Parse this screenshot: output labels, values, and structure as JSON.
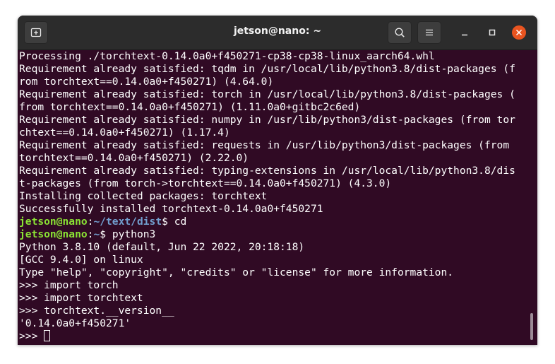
{
  "window": {
    "title": "jetson@nano: ~"
  },
  "icons": {
    "new_tab": "new-tab-icon",
    "search": "search-icon",
    "menu": "hamburger-menu-icon",
    "minimize": "minimize-icon",
    "maximize": "maximize-icon",
    "close": "close-icon"
  },
  "colors": {
    "terminal_bg": "#300a24",
    "titlebar_bg": "#2c2c2c",
    "prompt_user": "#8ae234",
    "prompt_path": "#729fcf",
    "close_button": "#e95420"
  },
  "terminal": {
    "lines": [
      "Processing ./torchtext-0.14.0a0+f450271-cp38-cp38-linux_aarch64.whl",
      "Requirement already satisfied: tqdm in /usr/local/lib/python3.8/dist-packages (f",
      "rom torchtext==0.14.0a0+f450271) (4.64.0)",
      "Requirement already satisfied: torch in /usr/local/lib/python3.8/dist-packages (",
      "from torchtext==0.14.0a0+f450271) (1.11.0a0+gitbc2c6ed)",
      "Requirement already satisfied: numpy in /usr/lib/python3/dist-packages (from tor",
      "chtext==0.14.0a0+f450271) (1.17.4)",
      "Requirement already satisfied: requests in /usr/lib/python3/dist-packages (from",
      "torchtext==0.14.0a0+f450271) (2.22.0)",
      "Requirement already satisfied: typing-extensions in /usr/local/lib/python3.8/dis",
      "t-packages (from torch->torchtext==0.14.0a0+f450271) (4.3.0)",
      "Installing collected packages: torchtext",
      "Successfully installed torchtext-0.14.0a0+f450271"
    ],
    "prompt1": {
      "user": "jetson@nano",
      "sep": ":",
      "path": "~/text/dist",
      "symbol": "$ ",
      "command": "cd"
    },
    "prompt2": {
      "user": "jetson@nano",
      "sep": ":",
      "path": "~",
      "symbol": "$ ",
      "command": "python3"
    },
    "python_lines": [
      "Python 3.8.10 (default, Jun 22 2022, 20:18:18)",
      "[GCC 9.4.0] on linux",
      "Type \"help\", \"copyright\", \"credits\" or \"license\" for more information.",
      ">>> import torch",
      ">>> import torchtext",
      ">>> torchtext.__version__",
      "'0.14.0a0+f450271'"
    ],
    "final_prompt": ">>> "
  }
}
